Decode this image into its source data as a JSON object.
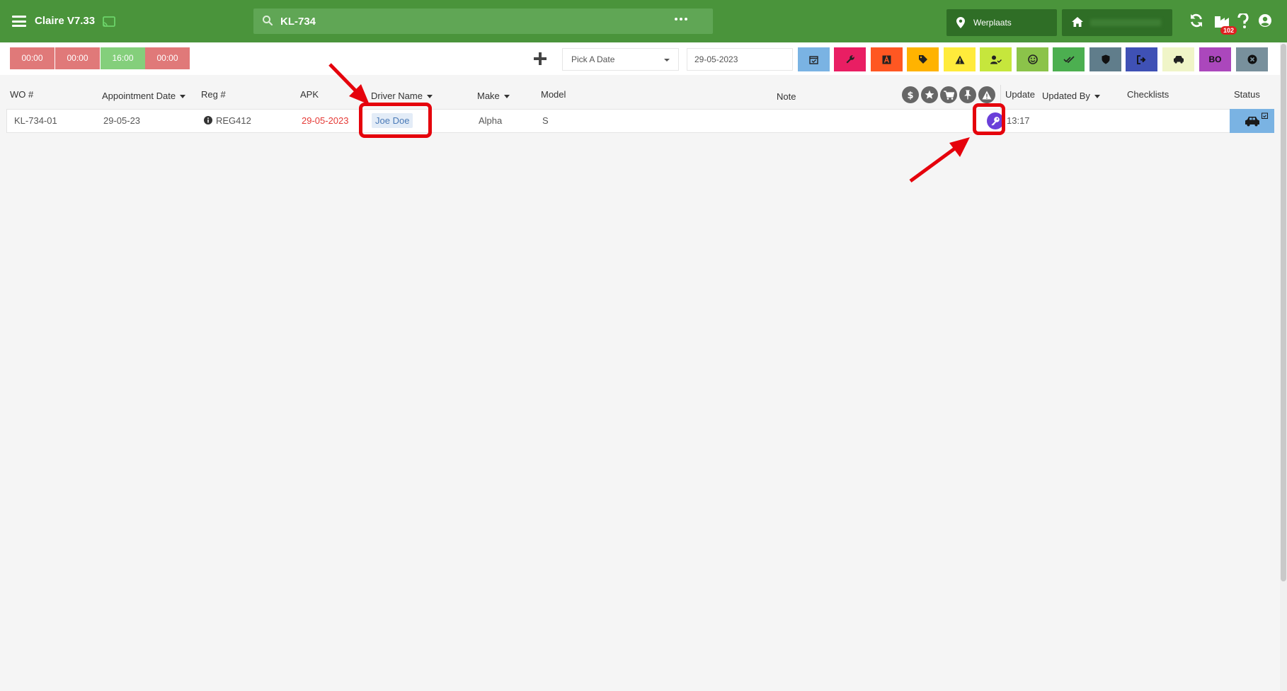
{
  "app": {
    "title": "Claire V7.33"
  },
  "search": {
    "value": "KL-734"
  },
  "header": {
    "location_label": "Werplaats",
    "home_label": "",
    "notification_count": "102"
  },
  "colors": {
    "brand": "#4a943b",
    "brand_dark": "#2f6e26",
    "alert": "#e5020c"
  },
  "time_slots": [
    "00:00",
    "00:00",
    "16:00",
    "00:00"
  ],
  "toolbar": {
    "date_picker_placeholder": "Pick A Date",
    "date_value": "29-05-2023",
    "filter_buttons": [
      {
        "name": "calendar-check",
        "color": "#7ab3e3"
      },
      {
        "name": "wrench",
        "color": "#e91e63"
      },
      {
        "name": "letter-a",
        "color": "#ff5722"
      },
      {
        "name": "tag",
        "color": "#ffb300"
      },
      {
        "name": "warning",
        "color": "#ffeb3b"
      },
      {
        "name": "user-check",
        "color": "#c6e63c"
      },
      {
        "name": "smiley",
        "color": "#8bc34a"
      },
      {
        "name": "double-check",
        "color": "#4caf50"
      },
      {
        "name": "shield",
        "color": "#607d8b"
      },
      {
        "name": "sign-out",
        "color": "#3f51b5"
      },
      {
        "name": "car",
        "color": "#f0f5c8"
      },
      {
        "name": "bo",
        "color": "#ab47bc",
        "label": "BO"
      },
      {
        "name": "close-circle",
        "color": "#78909c"
      }
    ]
  },
  "table": {
    "headers": {
      "wo": "WO #",
      "appointment_date": "Appointment Date",
      "reg": "Reg #",
      "apk": "APK",
      "driver_name": "Driver Name",
      "make": "Make",
      "model": "Model",
      "note": "Note",
      "update": "Update",
      "updated_by": "Updated By",
      "checklists": "Checklists",
      "status": "Status"
    },
    "flag_icons": [
      "dollar",
      "star",
      "cart",
      "pin",
      "warning"
    ],
    "rows": [
      {
        "wo": "KL-734-01",
        "appointment_date": "29-05-23",
        "reg": "REG412",
        "apk": "29-05-2023",
        "driver_name": "Joe Doe",
        "make": "Alpha",
        "model": "S",
        "note": "",
        "update": "13:17",
        "updated_by": "",
        "checklists": ""
      }
    ]
  }
}
